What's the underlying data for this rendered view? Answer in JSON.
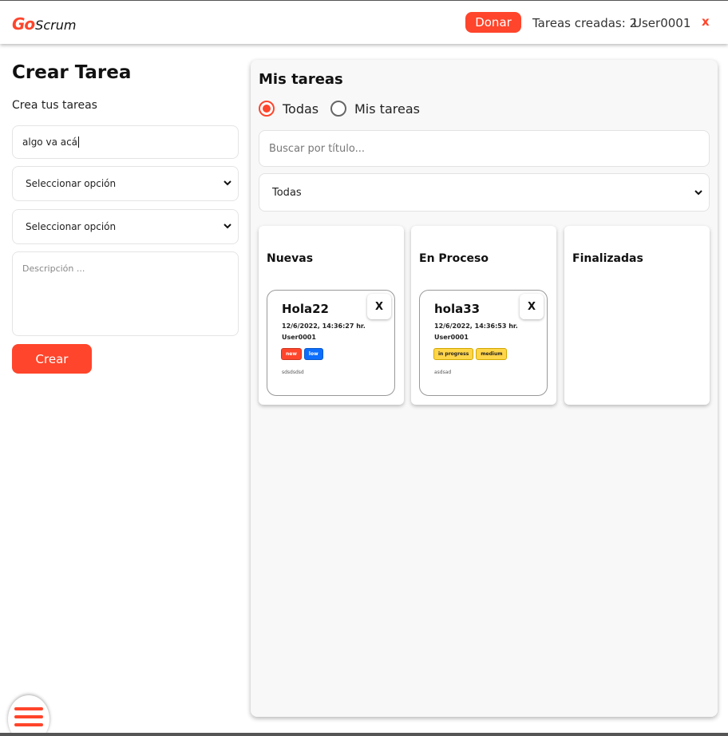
{
  "header": {
    "logo_go": "Go",
    "logo_scrum": "Scrum",
    "donate_label": "Donar",
    "tasks_created": "Tareas creadas: 2",
    "username": "User0001",
    "logout_label": "x",
    "accent_color": "#ff452b"
  },
  "form": {
    "title": "Crear Tarea",
    "subtitle": "Crea tus tareas",
    "title_value": "algo va acá",
    "status_select": "Seleccionar opción",
    "priority_select": "Seleccionar opción",
    "description_placeholder": "Descripción ...",
    "submit_label": "Crear"
  },
  "panel": {
    "title": "Mis tareas",
    "radios": [
      {
        "label": "Todas",
        "selected": true
      },
      {
        "label": "Mis tareas",
        "selected": false
      }
    ],
    "search_placeholder": "Buscar por título...",
    "filter_value": "Todas",
    "columns": [
      {
        "title": "Nuevas",
        "cards": [
          {
            "title": "Hola22",
            "datetime": "12/6/2022, 14:36:27 hr.",
            "user": "User0001",
            "tags": [
              "new",
              "low"
            ],
            "description": "sdsdsdsd",
            "close_label": "X"
          }
        ]
      },
      {
        "title": "En Proceso",
        "cards": [
          {
            "title": "hola33",
            "datetime": "12/6/2022, 14:36:53 hr.",
            "user": "User0001",
            "tags": [
              "in progress",
              "medium"
            ],
            "description": "asdsad",
            "close_label": "X"
          }
        ]
      },
      {
        "title": "Finalizadas",
        "cards": []
      }
    ]
  },
  "icons": {
    "menu": "hamburger-menu-icon",
    "select_arrow": "chevron-down-icon"
  }
}
